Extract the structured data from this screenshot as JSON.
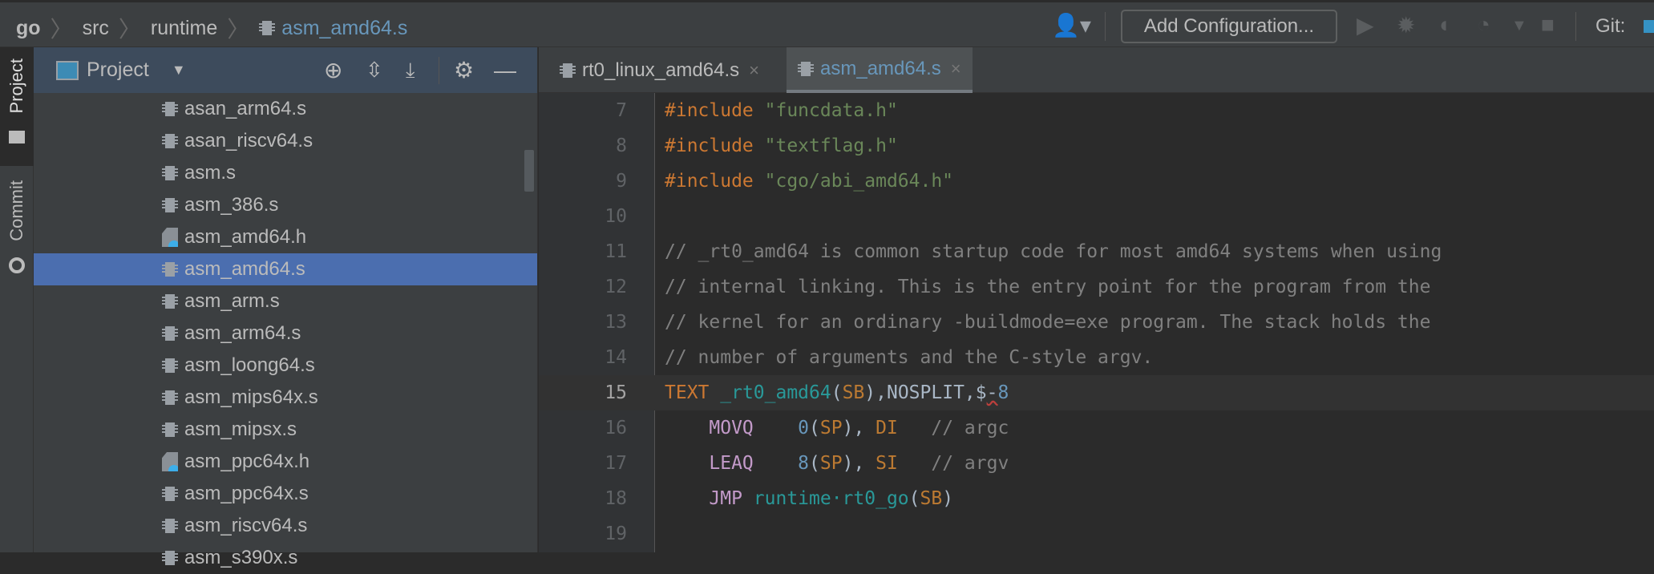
{
  "breadcrumb": [
    "go",
    "src",
    "runtime",
    "asm_amd64.s"
  ],
  "toolbar": {
    "config_label": "Add Configuration...",
    "git_label": "Git:"
  },
  "side_strip": {
    "project": "Project",
    "commit": "Commit"
  },
  "panel": {
    "title": "Project",
    "files": [
      {
        "name": "asan_arm64.s",
        "type": "asm"
      },
      {
        "name": "asan_riscv64.s",
        "type": "asm"
      },
      {
        "name": "asm.s",
        "type": "asm"
      },
      {
        "name": "asm_386.s",
        "type": "asm"
      },
      {
        "name": "asm_amd64.h",
        "type": "header"
      },
      {
        "name": "asm_amd64.s",
        "type": "asm",
        "selected": true
      },
      {
        "name": "asm_arm.s",
        "type": "asm"
      },
      {
        "name": "asm_arm64.s",
        "type": "asm"
      },
      {
        "name": "asm_loong64.s",
        "type": "asm"
      },
      {
        "name": "asm_mips64x.s",
        "type": "asm"
      },
      {
        "name": "asm_mipsx.s",
        "type": "asm"
      },
      {
        "name": "asm_ppc64x.h",
        "type": "header"
      },
      {
        "name": "asm_ppc64x.s",
        "type": "asm"
      },
      {
        "name": "asm_riscv64.s",
        "type": "asm"
      },
      {
        "name": "asm_s390x.s",
        "type": "asm"
      }
    ]
  },
  "tabs": [
    {
      "label": "rt0_linux_amd64.s",
      "close": "×"
    },
    {
      "label": "asm_amd64.s",
      "close": "×",
      "active": true
    }
  ],
  "editor": {
    "current_line": 15,
    "lines": [
      {
        "n": "7",
        "tokens": [
          [
            "kw",
            "#include "
          ],
          [
            "str",
            "\"funcdata.h\""
          ]
        ]
      },
      {
        "n": "8",
        "tokens": [
          [
            "kw",
            "#include "
          ],
          [
            "str",
            "\"textflag.h\""
          ]
        ]
      },
      {
        "n": "9",
        "tokens": [
          [
            "kw",
            "#include "
          ],
          [
            "str",
            "\"cgo/abi_amd64.h\""
          ]
        ]
      },
      {
        "n": "10",
        "tokens": []
      },
      {
        "n": "11",
        "tokens": [
          [
            "cm",
            "// _rt0_amd64 is common startup code for most amd64 systems when using"
          ]
        ]
      },
      {
        "n": "12",
        "tokens": [
          [
            "cm",
            "// internal linking. This is the entry point for the program from the"
          ]
        ]
      },
      {
        "n": "13",
        "tokens": [
          [
            "cm",
            "// kernel for an ordinary -buildmode=exe program. The stack holds the"
          ]
        ]
      },
      {
        "n": "14",
        "tokens": [
          [
            "cm",
            "// number of arguments and the C-style argv."
          ]
        ]
      },
      {
        "n": "15",
        "tokens": [
          [
            "kw",
            "TEXT "
          ],
          [
            "fn",
            "_rt0_amd64"
          ],
          [
            "pl",
            "("
          ],
          [
            "reg",
            "SB"
          ],
          [
            "pl",
            "),NOSPLIT,$"
          ],
          [
            "pl squig",
            "-"
          ],
          [
            "num",
            "8"
          ]
        ]
      },
      {
        "n": "16",
        "tokens": [
          [
            "pl",
            "    "
          ],
          [
            "op",
            "MOVQ"
          ],
          [
            "pl",
            "    "
          ],
          [
            "num",
            "0"
          ],
          [
            "pl",
            "("
          ],
          [
            "reg",
            "SP"
          ],
          [
            "pl",
            "), "
          ],
          [
            "reg",
            "DI"
          ],
          [
            "pl",
            "   "
          ],
          [
            "cm",
            "// argc"
          ]
        ]
      },
      {
        "n": "17",
        "tokens": [
          [
            "pl",
            "    "
          ],
          [
            "op",
            "LEAQ"
          ],
          [
            "pl",
            "    "
          ],
          [
            "num",
            "8"
          ],
          [
            "pl",
            "("
          ],
          [
            "reg",
            "SP"
          ],
          [
            "pl",
            "), "
          ],
          [
            "reg",
            "SI"
          ],
          [
            "pl",
            "   "
          ],
          [
            "cm",
            "// argv"
          ]
        ]
      },
      {
        "n": "18",
        "tokens": [
          [
            "pl",
            "    "
          ],
          [
            "op",
            "JMP "
          ],
          [
            "fn",
            "runtime·rt0_go"
          ],
          [
            "pl",
            "("
          ],
          [
            "reg",
            "SB"
          ],
          [
            "pl",
            ")"
          ]
        ]
      },
      {
        "n": "19",
        "tokens": []
      }
    ]
  }
}
